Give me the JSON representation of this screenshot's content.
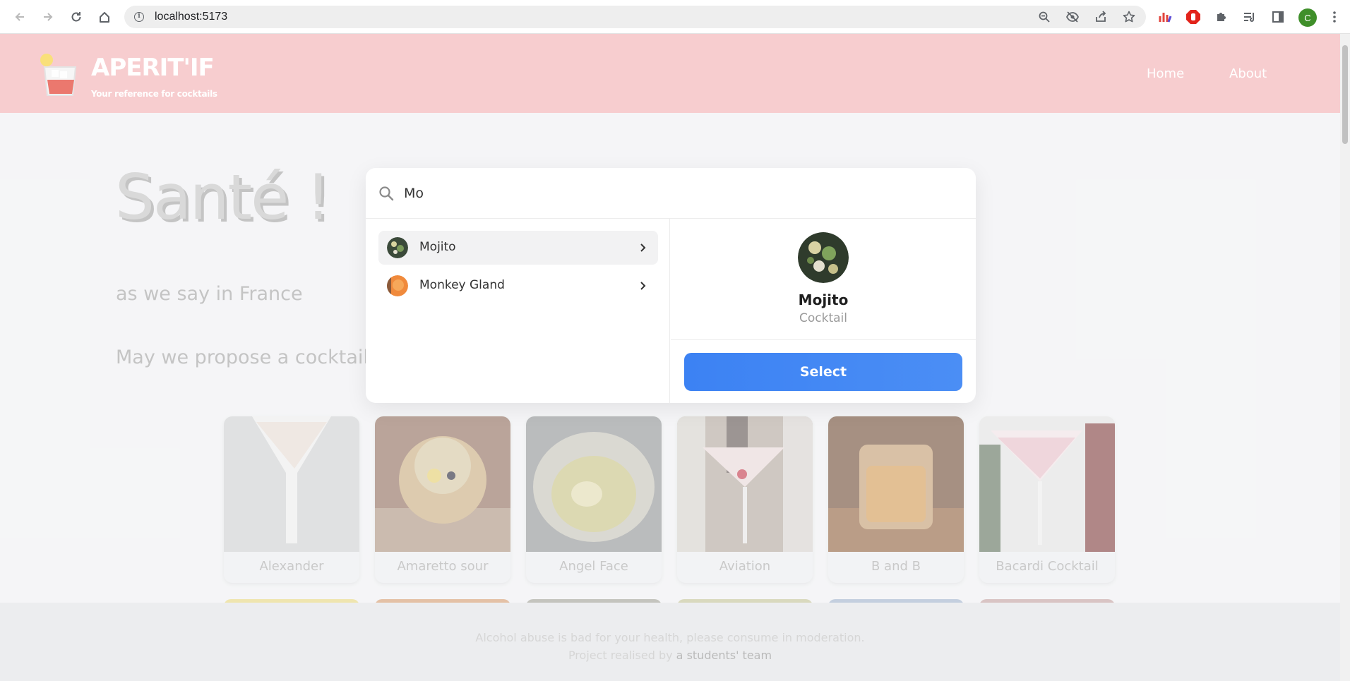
{
  "browser": {
    "url": "localhost:5173",
    "profile_initial": "C"
  },
  "header": {
    "brand": "APERIT'IF",
    "tagline": "Your reference for cocktails",
    "nav": [
      {
        "label": "Home"
      },
      {
        "label": "About"
      }
    ]
  },
  "hero": {
    "title": "Santé !",
    "subtitle": "as we say in France",
    "prompt": "May we propose a cocktail"
  },
  "cocktails": [
    {
      "name": "Alexander"
    },
    {
      "name": "Amaretto sour"
    },
    {
      "name": "Angel Face"
    },
    {
      "name": "Aviation"
    },
    {
      "name": "B and B"
    },
    {
      "name": "Bacardi Cocktail"
    }
  ],
  "search": {
    "query": "Mo",
    "results": [
      {
        "label": "Mojito"
      },
      {
        "label": "Monkey Gland"
      }
    ],
    "preview": {
      "name": "Mojito",
      "type": "Cocktail"
    },
    "select_label": "Select"
  },
  "footer": {
    "warning": "Alcohol abuse is bad for your health, please consume in moderation.",
    "credit_prefix": "Project realised by",
    "credit_link": "a students' team"
  },
  "colors": {
    "header_bg": "#f4b6b9",
    "accent": "#3c82f3"
  }
}
